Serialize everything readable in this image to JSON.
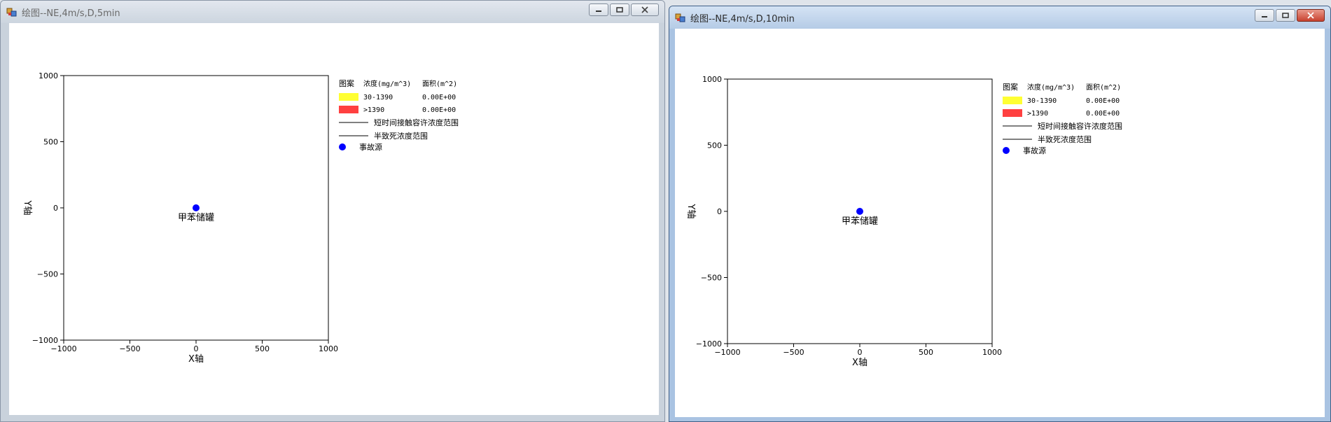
{
  "windows": [
    {
      "title": "绘图--NE,4m/s,D,5min",
      "plot": {
        "xlabel": "X轴",
        "ylabel": "Y轴",
        "xticks": [
          "−1000",
          "−500",
          "0",
          "500",
          "1000"
        ],
        "yticks": [
          "1000",
          "500",
          "0",
          "−500",
          "−1000"
        ],
        "source_label": "甲苯储罐"
      },
      "legend": {
        "header_pattern": "图案",
        "header_concentration": "浓度(mg/m^3)",
        "header_area": "面积(m^2)",
        "rows": [
          {
            "range": "30-1390",
            "area": "0.00E+00",
            "color": "#ffff33"
          },
          {
            "range": ">1390",
            "area": "0.00E+00",
            "color": "#ff4040"
          }
        ],
        "line1": "短时间接触容许浓度范围",
        "line2": "半致死浓度范围",
        "source": "事故源"
      }
    },
    {
      "title": "绘图--NE,4m/s,D,10min",
      "plot": {
        "xlabel": "X轴",
        "ylabel": "Y轴",
        "xticks": [
          "−1000",
          "−500",
          "0",
          "500",
          "1000"
        ],
        "yticks": [
          "1000",
          "500",
          "0",
          "−500",
          "−1000"
        ],
        "source_label": "甲苯储罐"
      },
      "legend": {
        "header_pattern": "图案",
        "header_concentration": "浓度(mg/m^3)",
        "header_area": "面积(m^2)",
        "rows": [
          {
            "range": "30-1390",
            "area": "0.00E+00",
            "color": "#ffff33"
          },
          {
            "range": ">1390",
            "area": "0.00E+00",
            "color": "#ff4040"
          }
        ],
        "line1": "短时间接触容许浓度范围",
        "line2": "半致死浓度范围",
        "source": "事故源"
      }
    }
  ],
  "chart_data": [
    {
      "type": "scatter",
      "xlabel": "X轴",
      "ylabel": "Y轴",
      "xlim": [
        -1000,
        1000
      ],
      "ylim": [
        -1000,
        1000
      ],
      "x_ticks": [
        -1000,
        -500,
        0,
        500,
        1000
      ],
      "y_ticks": [
        -1000,
        -500,
        0,
        500,
        1000
      ],
      "points": [
        {
          "x": 0,
          "y": 0,
          "label": "甲苯储罐",
          "color": "#0000ff"
        }
      ],
      "legend_placement": "right"
    },
    {
      "type": "scatter",
      "xlabel": "X轴",
      "ylabel": "Y轴",
      "xlim": [
        -1000,
        1000
      ],
      "ylim": [
        -1000,
        1000
      ],
      "x_ticks": [
        -1000,
        -500,
        0,
        500,
        1000
      ],
      "y_ticks": [
        -1000,
        -500,
        0,
        500,
        1000
      ],
      "points": [
        {
          "x": 0,
          "y": 0,
          "label": "甲苯储罐",
          "color": "#0000ff"
        }
      ],
      "legend_placement": "right"
    }
  ]
}
